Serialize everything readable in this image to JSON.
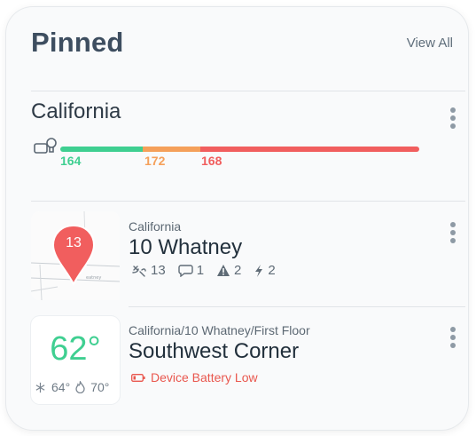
{
  "header": {
    "title": "Pinned",
    "view_all": "View All"
  },
  "group": {
    "title": "California",
    "counts": [
      {
        "value": "164",
        "color": "#3fcf91",
        "share": 0.23
      },
      {
        "value": "172",
        "color": "#f5a05a",
        "share": 0.16
      },
      {
        "value": "168",
        "color": "#f15e5e",
        "share": 0.61
      }
    ]
  },
  "building": {
    "path": "California",
    "name": "10 Whatney",
    "pin_number": "13",
    "map_street_label": "eatney",
    "stats": {
      "devices": "13",
      "comments": "1",
      "warnings": "2",
      "power": "2"
    }
  },
  "space": {
    "path": "California/10 Whatney/First Floor",
    "name": "Southwest Corner",
    "temperature": "62°",
    "cool_setpoint": "64°",
    "heat_setpoint": "70°",
    "alert": "Device Battery Low"
  },
  "icons": {
    "bulb": "bulb-icon",
    "devices": "plug-icon",
    "comments": "comment-icon",
    "warnings": "warning-icon",
    "power": "lightning-icon",
    "cool": "snowflake-icon",
    "heat": "flame-icon",
    "battery": "battery-icon",
    "menu": "more-vertical-icon",
    "pin": "map-pin-icon"
  }
}
